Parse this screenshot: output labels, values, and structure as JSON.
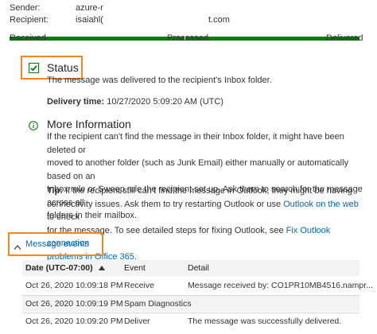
{
  "header": {
    "sender_label": "Sender:",
    "sender_value": "azure-r",
    "recipient_label": "Recipient:",
    "recipient_value_start": "isaiahl(",
    "recipient_value_end": "t.com"
  },
  "progress": {
    "steps": [
      "Received",
      "Processed",
      "Delivered"
    ],
    "fraction": 1.0,
    "color": "#107c10"
  },
  "status": {
    "title": "Status",
    "text": "The message was delivered to the recipient's Inbox folder.",
    "delivery_label": "Delivery time:",
    "delivery_value": "10/27/2020 5:09:20 AM (UTC)"
  },
  "more_info": {
    "title": "More Information",
    "p1": [
      "If the recipient can't find the message in their Inbox folder, it might have been deleted or",
      "moved to another folder (such as Junk Email) either manually or automatically based on an",
      "Inbox rule or Sweep rule the recipient set up. Ask them to search for the message across all",
      "folders in their mailbox."
    ],
    "tip_label": "Tip:",
    "tip_line1": "If the recipient still can't find the message in Outlook, they might be having",
    "tip_line2_pre": "connectivity issues. Ask them to try restarting Outlook or use ",
    "tip_link1": "Outlook on the web",
    "tip_line2_post": " to check",
    "tip_line3_pre": "for the message. To see detailed steps for fixing Outlook, see ",
    "tip_link2a": "Fix Outlook connection",
    "tip_link2b": "problems in Office 365",
    "tip_line4_post": "."
  },
  "events": {
    "toggle_label": "Message events",
    "columns": [
      "Date (UTC-07:00)",
      "Event",
      "Detail"
    ],
    "rows": [
      {
        "date": "Oct 26, 2020 10:09:18 PM",
        "event": "Receive",
        "detail": "Message received by: CO1PR10MB4516.nampr..."
      },
      {
        "date": "Oct 26, 2020 10:09:19 PM",
        "event": "Spam Diagnostics",
        "detail": ""
      },
      {
        "date": "Oct 26, 2020 10:09:20 PM",
        "event": "Deliver",
        "detail": "The message was successfully delivered."
      }
    ]
  },
  "colors": {
    "accent_orange": "#f5871f",
    "success_green": "#107c10",
    "link_blue": "#0069c2"
  }
}
